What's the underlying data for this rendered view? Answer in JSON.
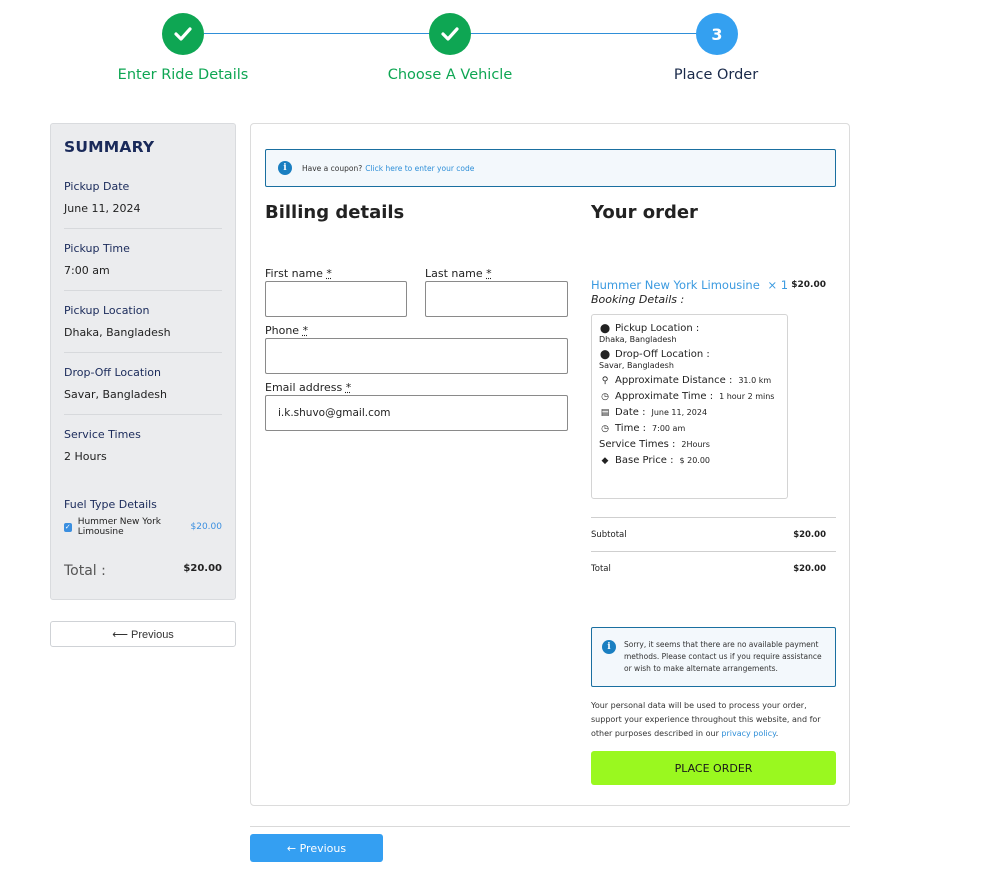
{
  "stepper": {
    "steps": [
      {
        "label": "Enter Ride Details",
        "state": "done",
        "icon": "check-icon"
      },
      {
        "label": "Choose A Vehicle",
        "state": "done",
        "icon": "check-icon"
      },
      {
        "label": "Place Order",
        "state": "current",
        "number": "3"
      }
    ]
  },
  "summary": {
    "title": "SUMMARY",
    "items": [
      {
        "label": "Pickup Date",
        "value": "June 11, 2024"
      },
      {
        "label": "Pickup Time",
        "value": "7:00 am"
      },
      {
        "label": "Pickup Location",
        "value": "Dhaka, Bangladesh"
      },
      {
        "label": "Drop-Off Location",
        "value": "Savar, Bangladesh"
      },
      {
        "label": "Service Times",
        "value": "2  Hours"
      }
    ],
    "fuel": {
      "label": "Fuel Type Details",
      "item_name": "Hummer New York Limousine",
      "item_price": "$20.00",
      "checked": true
    },
    "total_label": "Total :",
    "total_value": "$20.00",
    "previous_label": "⟵ Previous"
  },
  "coupon": {
    "text": "Have a coupon?",
    "link": "Click here to enter your code"
  },
  "billing": {
    "title": "Billing details",
    "first_name_label": "First name",
    "last_name_label": "Last name",
    "phone_label": "Phone",
    "email_label": "Email address",
    "required_mark": "*",
    "first_name_value": "",
    "last_name_value": "",
    "phone_value": "",
    "email_value": "i.k.shuvo@gmail.com"
  },
  "order": {
    "title": "Your order",
    "item_name": "Hummer New York Limousine",
    "item_qty": "× 1",
    "item_price": "$20.00",
    "booking_label": "Booking Details :",
    "booking": {
      "pickup_label": "Pickup Location :",
      "pickup_value": "Dhaka, Bangladesh",
      "dropoff_label": "Drop-Off Location :",
      "dropoff_value": "Savar, Bangladesh",
      "distance_label": "Approximate Distance :",
      "distance_value": "31.0 km",
      "time_approx_label": "Approximate Time :",
      "time_approx_value": "1 hour 2 mins",
      "date_label": "Date :",
      "date_value": "June 11, 2024",
      "time_label": "Time :",
      "time_value": "7:00 am",
      "service_label": "Service Times :",
      "service_value": "2Hours",
      "base_price_label": "Base Price :",
      "base_price_value": "$  20.00"
    },
    "subtotal_label": "Subtotal",
    "subtotal_value": "$20.00",
    "total_label": "Total",
    "total_value": "$20.00",
    "payment_notice": "Sorry, it seems that there are no available payment methods. Please contact us if you require assistance or wish to make alternate arrangements.",
    "privacy_text": "Your personal data will be used to process your order, support your experience throughout this website, and for other purposes described in our",
    "privacy_link": "privacy policy",
    "privacy_end": ".",
    "place_order_label": "PLACE ORDER"
  },
  "footer": {
    "previous_label": "← Previous"
  },
  "colors": {
    "done": "#0ea653",
    "current": "#34a0f0",
    "place_order": "#9af81f",
    "link": "#2f8fd8"
  }
}
